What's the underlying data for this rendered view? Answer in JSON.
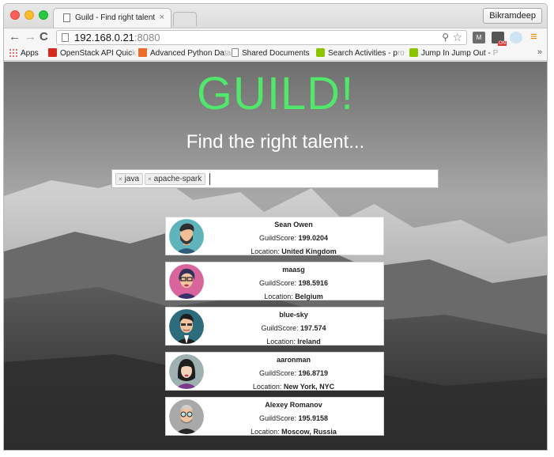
{
  "browser": {
    "tab_title": "Guild - Find right talent",
    "tab_close": "×",
    "profile_name": "Bikramdeep",
    "url_host": "192.168.0.21",
    "url_port": ":8080",
    "ext_m_label": "M",
    "menu_icon": "≡"
  },
  "bookmarks": [
    {
      "label": "Apps",
      "fade": "",
      "icon": "apps-grid-icon",
      "color": "#d44"
    },
    {
      "label": "OpenStack API Quic",
      "fade": "k",
      "icon": "openstack-icon",
      "color": "#d52b1e"
    },
    {
      "label": "Advanced Python Da",
      "fade": "ta",
      "icon": "python-icon",
      "color": "#ee6b2c"
    },
    {
      "label": "Shared Documents",
      "fade": "",
      "icon": "document-icon",
      "color": "#ffffff"
    },
    {
      "label": "Search Activities - p",
      "fade": "ro",
      "icon": "p-icon",
      "color": "#8ac500"
    },
    {
      "label": "Jump In Jump Out - ",
      "fade": "P",
      "icon": "p-icon",
      "color": "#8ac500"
    }
  ],
  "bookmarks_more": "»",
  "page": {
    "logo": "GUILD!",
    "tagline": "Find the right talent...",
    "tags": [
      "java",
      "apache-spark"
    ],
    "tag_remove": "×",
    "score_label": "GuildScore: ",
    "location_label": "Location: "
  },
  "colors": {
    "logo": "#53e66d",
    "tag_bg": "#efefef"
  },
  "results": [
    {
      "name": "Sean Owen",
      "score": "199.0204",
      "location": "United Kingdom",
      "avatar": "avatar-teal-beard"
    },
    {
      "name": "maasg",
      "score": "198.5916",
      "location": "Belgium",
      "avatar": "avatar-pink-glasses"
    },
    {
      "name": "blue-sky",
      "score": "197.574",
      "location": "Ireland",
      "avatar": "avatar-teal-suit"
    },
    {
      "name": "aaronman",
      "score": "196.8719",
      "location": "New York, NYC",
      "avatar": "avatar-grey-woman"
    },
    {
      "name": "Alexey Romanov",
      "score": "195.9158",
      "location": "Moscow, Russia",
      "avatar": "avatar-grey-glasses"
    }
  ]
}
